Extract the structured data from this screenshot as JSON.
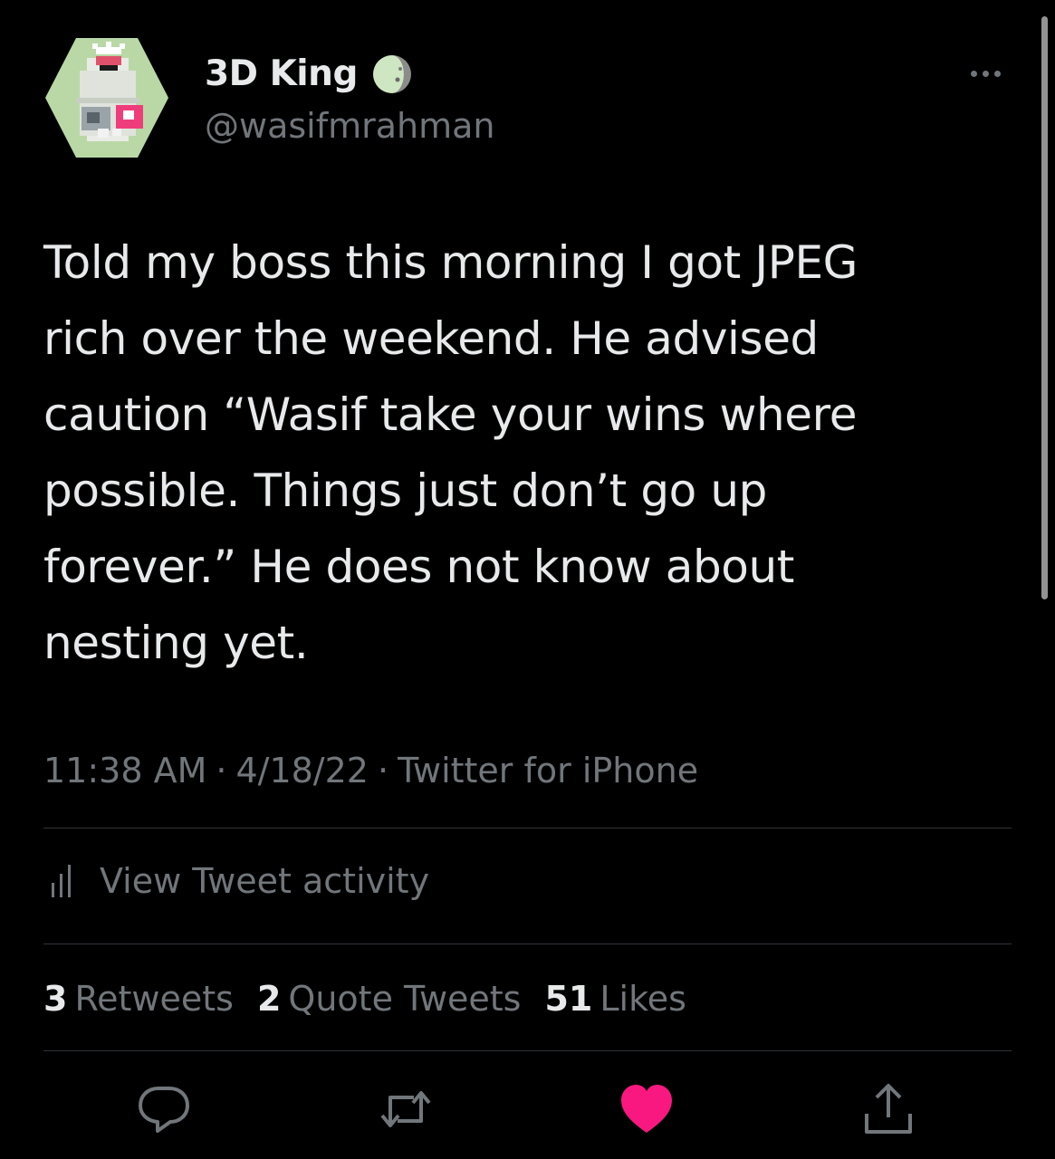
{
  "tweet": {
    "author": {
      "display_name": "3D King",
      "handle": "@wasifmrahman",
      "avatar_icon": "pixel-penguin-avatar-icon",
      "badge_icon": "moon-icon"
    },
    "more_icon": "more-dots-icon",
    "text": "Told my boss this morning I got JPEG\nrich over the weekend. He advised\ncaution “Wasif take your wins where\npossible. Things just don’t go up\nforever.” He does not know about\nnesting yet.",
    "time": "11:38 AM",
    "separator": "·",
    "date": "4/18/22",
    "source": "Twitter for iPhone",
    "activity": {
      "icon": "bar-chart-icon",
      "label": "View Tweet activity"
    },
    "stats": {
      "retweets_count": "3",
      "retweets_label": "Retweets",
      "quotes_count": "2",
      "quotes_label": "Quote Tweets",
      "likes_count": "51",
      "likes_label": "Likes"
    },
    "actions": [
      {
        "icon": "reply-icon"
      },
      {
        "icon": "retweet-icon"
      },
      {
        "icon": "heart-icon",
        "active": true
      },
      {
        "icon": "share-icon"
      }
    ]
  },
  "colors": {
    "background": "#000000",
    "primary_text": "#e7e9ea",
    "secondary_text": "#71767b",
    "divider": "#2f3336",
    "like_active": "#f91880"
  }
}
